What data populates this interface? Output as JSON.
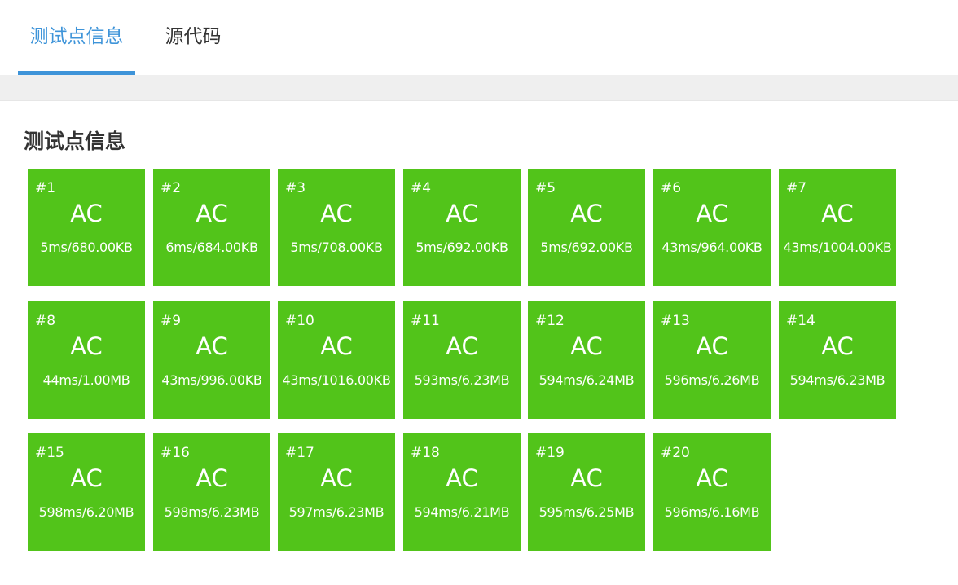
{
  "tabs": [
    {
      "label": "测试点信息",
      "active": true
    },
    {
      "label": "源代码",
      "active": false
    }
  ],
  "section_title": "测试点信息",
  "colors": {
    "accent": "#3e94d9",
    "ac": "#52c41a",
    "band": "#efefef"
  },
  "testcases": [
    {
      "id": "#1",
      "status": "AC",
      "usage": "5ms/680.00KB"
    },
    {
      "id": "#2",
      "status": "AC",
      "usage": "6ms/684.00KB"
    },
    {
      "id": "#3",
      "status": "AC",
      "usage": "5ms/708.00KB"
    },
    {
      "id": "#4",
      "status": "AC",
      "usage": "5ms/692.00KB"
    },
    {
      "id": "#5",
      "status": "AC",
      "usage": "5ms/692.00KB"
    },
    {
      "id": "#6",
      "status": "AC",
      "usage": "43ms/964.00KB"
    },
    {
      "id": "#7",
      "status": "AC",
      "usage": "43ms/1004.00KB"
    },
    {
      "id": "#8",
      "status": "AC",
      "usage": "44ms/1.00MB"
    },
    {
      "id": "#9",
      "status": "AC",
      "usage": "43ms/996.00KB"
    },
    {
      "id": "#10",
      "status": "AC",
      "usage": "43ms/1016.00KB"
    },
    {
      "id": "#11",
      "status": "AC",
      "usage": "593ms/6.23MB"
    },
    {
      "id": "#12",
      "status": "AC",
      "usage": "594ms/6.24MB"
    },
    {
      "id": "#13",
      "status": "AC",
      "usage": "596ms/6.26MB"
    },
    {
      "id": "#14",
      "status": "AC",
      "usage": "594ms/6.23MB"
    },
    {
      "id": "#15",
      "status": "AC",
      "usage": "598ms/6.20MB"
    },
    {
      "id": "#16",
      "status": "AC",
      "usage": "598ms/6.23MB"
    },
    {
      "id": "#17",
      "status": "AC",
      "usage": "597ms/6.23MB"
    },
    {
      "id": "#18",
      "status": "AC",
      "usage": "594ms/6.21MB"
    },
    {
      "id": "#19",
      "status": "AC",
      "usage": "595ms/6.25MB"
    },
    {
      "id": "#20",
      "status": "AC",
      "usage": "596ms/6.16MB"
    }
  ]
}
